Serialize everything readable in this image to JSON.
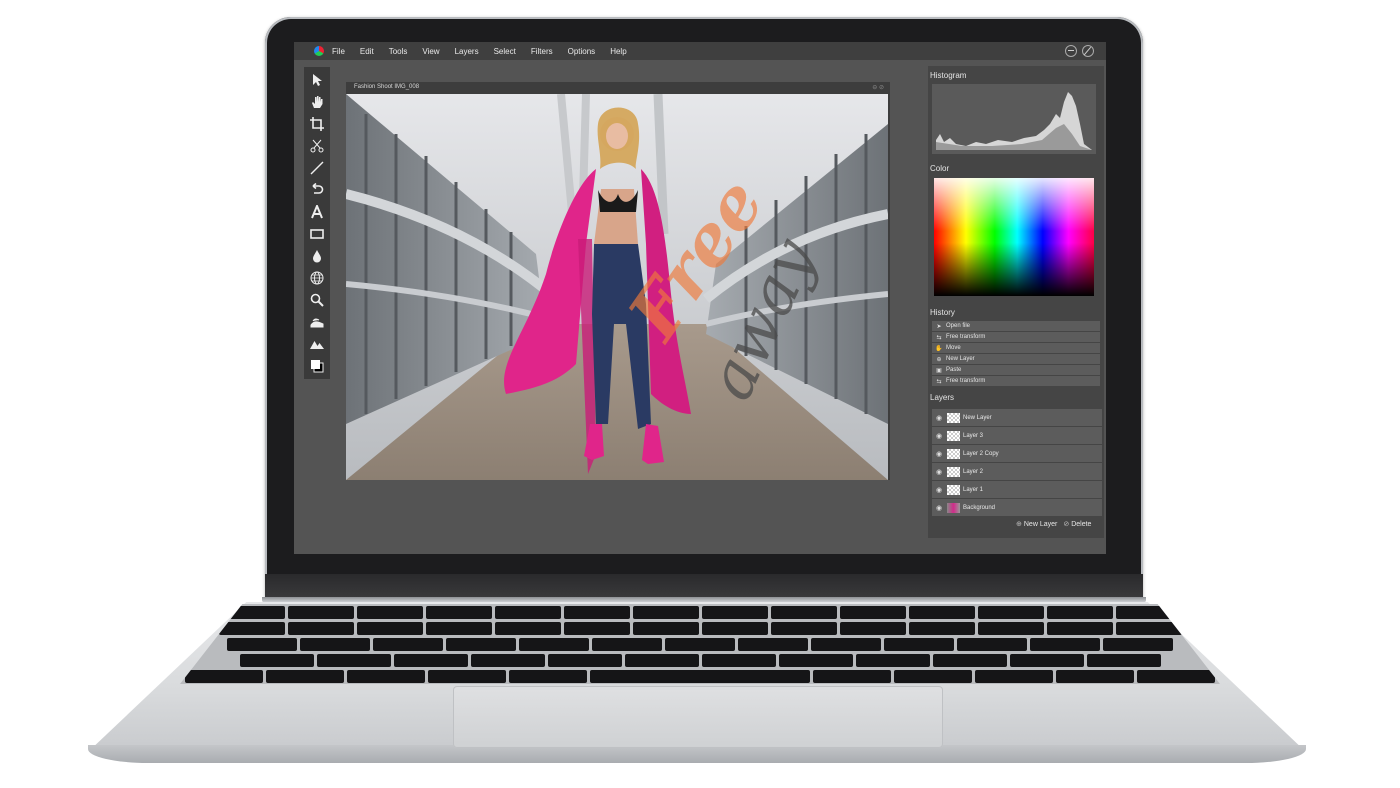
{
  "menubar": {
    "items": [
      "File",
      "Edit",
      "Tools",
      "View",
      "Layers",
      "Select",
      "Filters",
      "Options",
      "Help"
    ]
  },
  "tools": [
    {
      "name": "pointer-icon",
      "glyph": "➤"
    },
    {
      "name": "hand-icon",
      "glyph": "✋"
    },
    {
      "name": "crop-icon",
      "glyph": "⌗"
    },
    {
      "name": "scissors-icon",
      "glyph": "✂"
    },
    {
      "name": "line-icon",
      "glyph": "/"
    },
    {
      "name": "undo-icon",
      "glyph": "↶"
    },
    {
      "name": "text-icon",
      "glyph": "A"
    },
    {
      "name": "rectangle-icon",
      "glyph": "▭"
    },
    {
      "name": "drop-icon",
      "glyph": "●"
    },
    {
      "name": "globe-icon",
      "glyph": "⊕"
    },
    {
      "name": "zoom-icon",
      "glyph": "⚲"
    },
    {
      "name": "smudge-icon",
      "glyph": "≈"
    },
    {
      "name": "mountains-icon",
      "glyph": "▲"
    },
    {
      "name": "swatches-icon",
      "glyph": "■"
    }
  ],
  "document": {
    "title": "Fashion Shoot IMG_008",
    "watermark_top": "Free",
    "watermark_bottom": "away"
  },
  "panels": {
    "histogram_title": "Histogram",
    "color_title": "Color",
    "history_title": "History",
    "layers_title": "Layers"
  },
  "history": [
    {
      "icon": "pointer-icon",
      "label": "Open file"
    },
    {
      "icon": "transform-icon",
      "label": "Free transform"
    },
    {
      "icon": "hand-icon",
      "label": "Move"
    },
    {
      "icon": "new-layer-icon",
      "label": "New Layer"
    },
    {
      "icon": "paste-icon",
      "label": "Paste"
    },
    {
      "icon": "transform-icon",
      "label": "Free transform"
    }
  ],
  "layers": [
    {
      "label": "New Layer"
    },
    {
      "label": "Layer 3"
    },
    {
      "label": "Layer 2 Copy"
    },
    {
      "label": "Layer 2"
    },
    {
      "label": "Layer 1"
    },
    {
      "label": "Background"
    }
  ],
  "layer_actions": {
    "new_label": "New Layer",
    "delete_label": "Delete"
  },
  "colors": {
    "screen_bg": "#545454",
    "panel_bg": "#454545",
    "dress": "#e0258a",
    "watermark": "#f07a3a"
  }
}
